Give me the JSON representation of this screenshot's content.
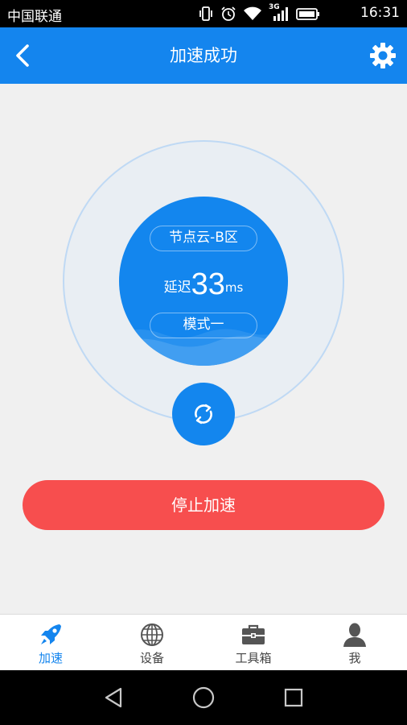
{
  "status_bar": {
    "carrier": "中国联通",
    "network_type": "3G",
    "time": "16:31",
    "icons": [
      "vibrate-icon",
      "alarm-icon",
      "wifi-icon",
      "signal-icon",
      "battery-icon"
    ]
  },
  "app_bar": {
    "title": "加速成功",
    "back_icon": "chevron-left-icon",
    "settings_icon": "gear-icon",
    "background_color": "#1485ee"
  },
  "accelerator": {
    "node": "节点云-B区",
    "latency_label": "延迟",
    "latency_value": "33",
    "latency_unit": "ms",
    "mode": "模式一",
    "refresh_icon": "refresh-icon",
    "circle_color": "#1386ee"
  },
  "stop_button": {
    "label": "停止加速",
    "color": "#f74e4e"
  },
  "bottom_nav": {
    "items": [
      {
        "label": "加速",
        "icon": "rocket-icon",
        "active": true
      },
      {
        "label": "设备",
        "icon": "globe-icon",
        "active": false
      },
      {
        "label": "工具箱",
        "icon": "toolbox-icon",
        "active": false
      },
      {
        "label": "我",
        "icon": "user-icon",
        "active": false
      }
    ],
    "active_color": "#1485ee"
  },
  "system_nav": {
    "icons": [
      "back-triangle-icon",
      "home-circle-icon",
      "recents-square-icon"
    ]
  }
}
